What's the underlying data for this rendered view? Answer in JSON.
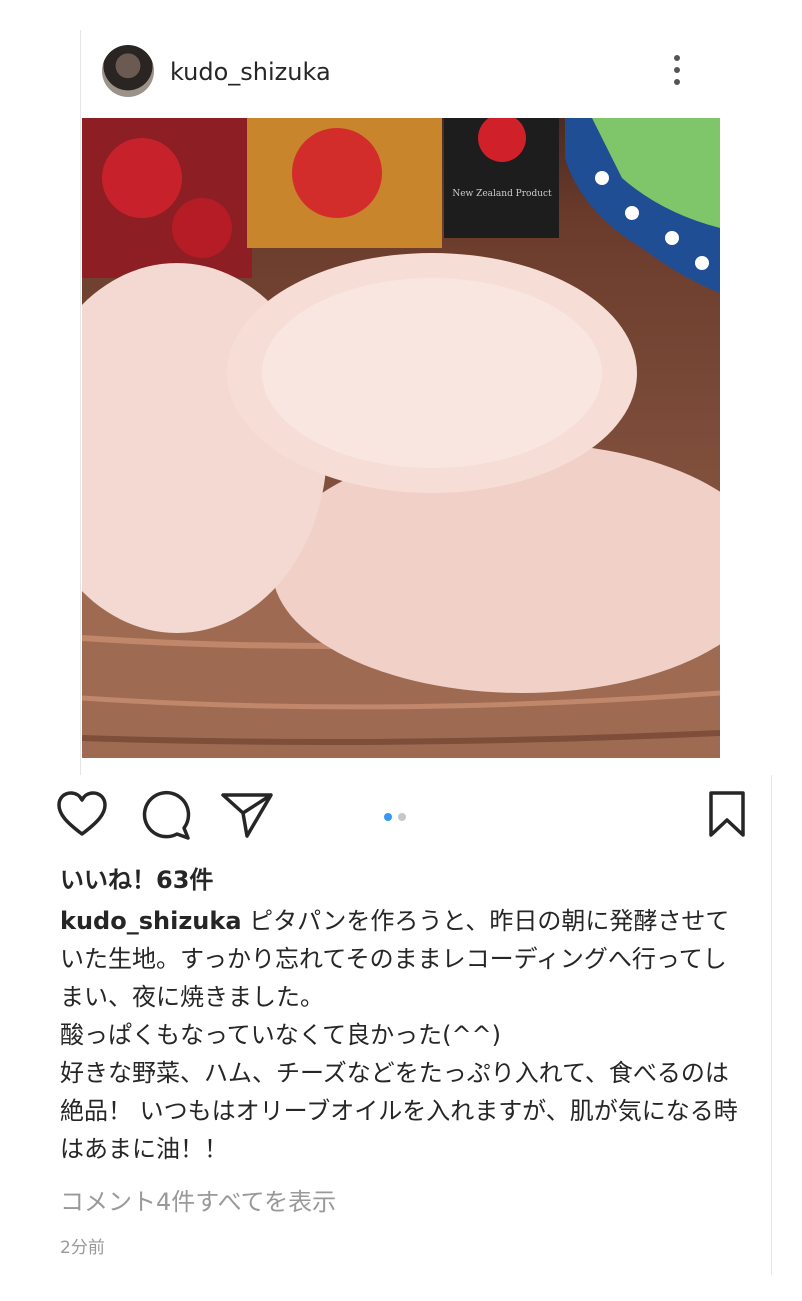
{
  "post": {
    "username": "kudo_shizuka",
    "likes": "いいね！63件",
    "caption_user": "kudo_shizuka",
    "caption_text": "ピタパンを作ろうと、昨日の朝に発酵させていた生地。すっかり忘れてそのままレコーディングへ行ってしまい、夜に焼きました。\n酸っぱくもなっていなくて良かった(^^)\n好きな野菜、ハム、チーズなどをたっぷり入れて、食べるのは絶品！ いつもはオリーブオイルを入れますが、肌が気になる時はあまに油！！",
    "view_comments": "コメント4件すべてを表示",
    "time": "2分前",
    "photo_label": "New Zealand Product",
    "carousel": {
      "active_color": "#3897f0",
      "inactive_color": "#c7c7c7",
      "count": 2,
      "active_index": 0
    }
  },
  "icons": [
    "heart-icon",
    "comment-icon",
    "share-icon",
    "bookmark-icon",
    "more-icon"
  ]
}
